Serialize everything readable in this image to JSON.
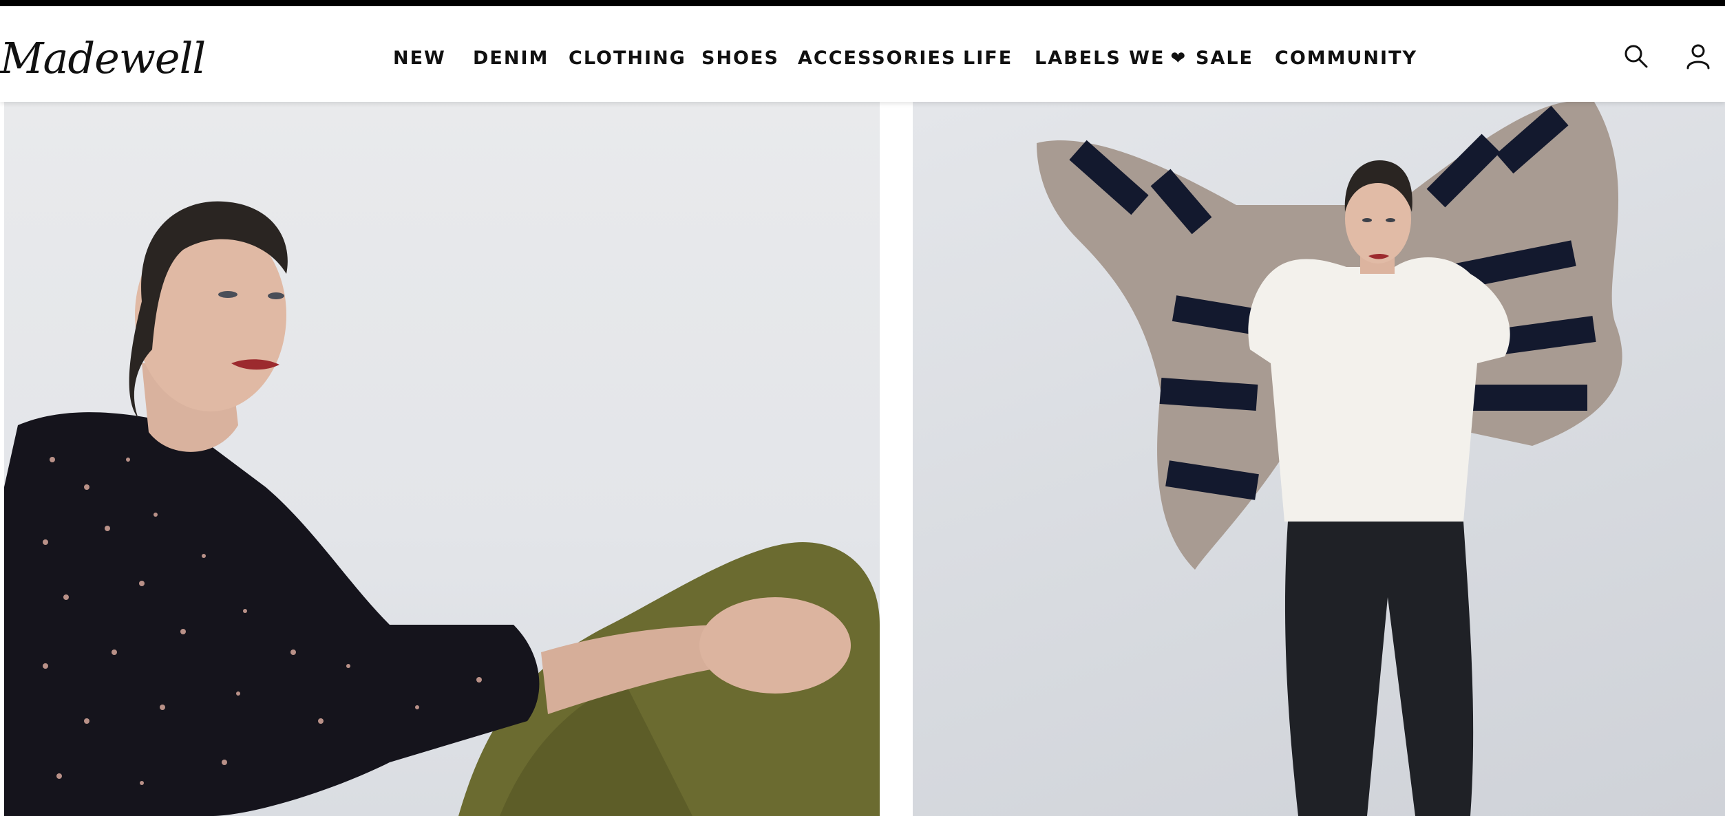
{
  "header": {
    "logo_text": "Madewell",
    "nav": [
      {
        "label": "NEW"
      },
      {
        "label": "DENIM"
      },
      {
        "label": "CLOTHING"
      },
      {
        "label": "SHOES"
      },
      {
        "label": "ACCESSORIES"
      },
      {
        "label": "LIFE"
      },
      {
        "label": "LABELS WE",
        "suffix_icon": "heart-icon"
      },
      {
        "label": "SALE"
      },
      {
        "label": "COMMUNITY"
      }
    ],
    "icons": [
      "search-icon",
      "account-icon"
    ]
  },
  "hero": {
    "left_image": "model-seated-black-polka-dot-blouse-olive-pants",
    "right_image": "model-standing-white-top-striped-blanket-coat-black-jeans"
  },
  "colors": {
    "topbar": "#000000",
    "text": "#111111",
    "background": "#ffffff"
  }
}
